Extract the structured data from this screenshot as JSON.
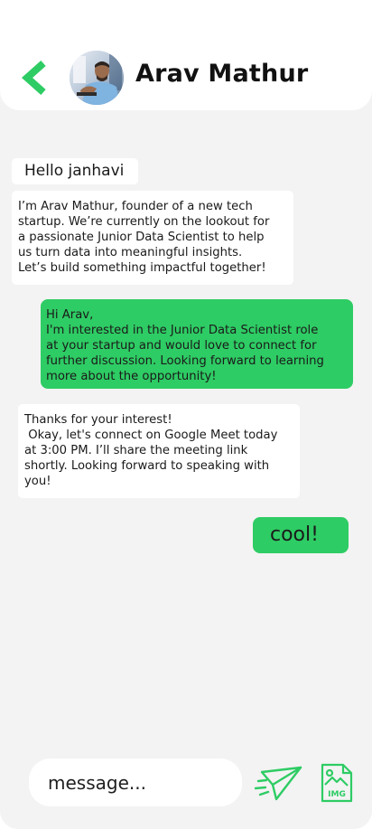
{
  "contact": {
    "name": "Arav Mathur"
  },
  "messages": [
    {
      "direction": "incoming",
      "text": "Hello janhavi"
    },
    {
      "direction": "incoming",
      "text": "I’m Arav Mathur, founder of a new tech\nstartup. We’re currently on the lookout for\na passionate Junior Data Scientist to help\nus turn data into meaningful insights.\nLet’s build something impactful together!"
    },
    {
      "direction": "outgoing",
      "text": "Hi Arav,\nI'm interested in the Junior Data Scientist role\nat your startup and would love to connect for\nfurther discussion. Looking forward to learning\nmore about the opportunity!"
    },
    {
      "direction": "incoming",
      "text": "Thanks for your interest!\n Okay, let's connect on Google Meet today\nat 3:00 PM. I’ll share the meeting link\nshortly. Looking forward to speaking with\nyou!"
    },
    {
      "direction": "outgoing",
      "text": "cool!"
    }
  ],
  "composer": {
    "placeholder": "message..."
  },
  "image_button": {
    "label": "IMG"
  },
  "icons": {
    "back": "chevron-left-icon",
    "send": "paper-plane-icon",
    "image": "image-file-icon"
  },
  "colors": {
    "accent": "#2ecc64",
    "background": "#f3f3f3",
    "bubble_incoming": "#ffffff"
  }
}
